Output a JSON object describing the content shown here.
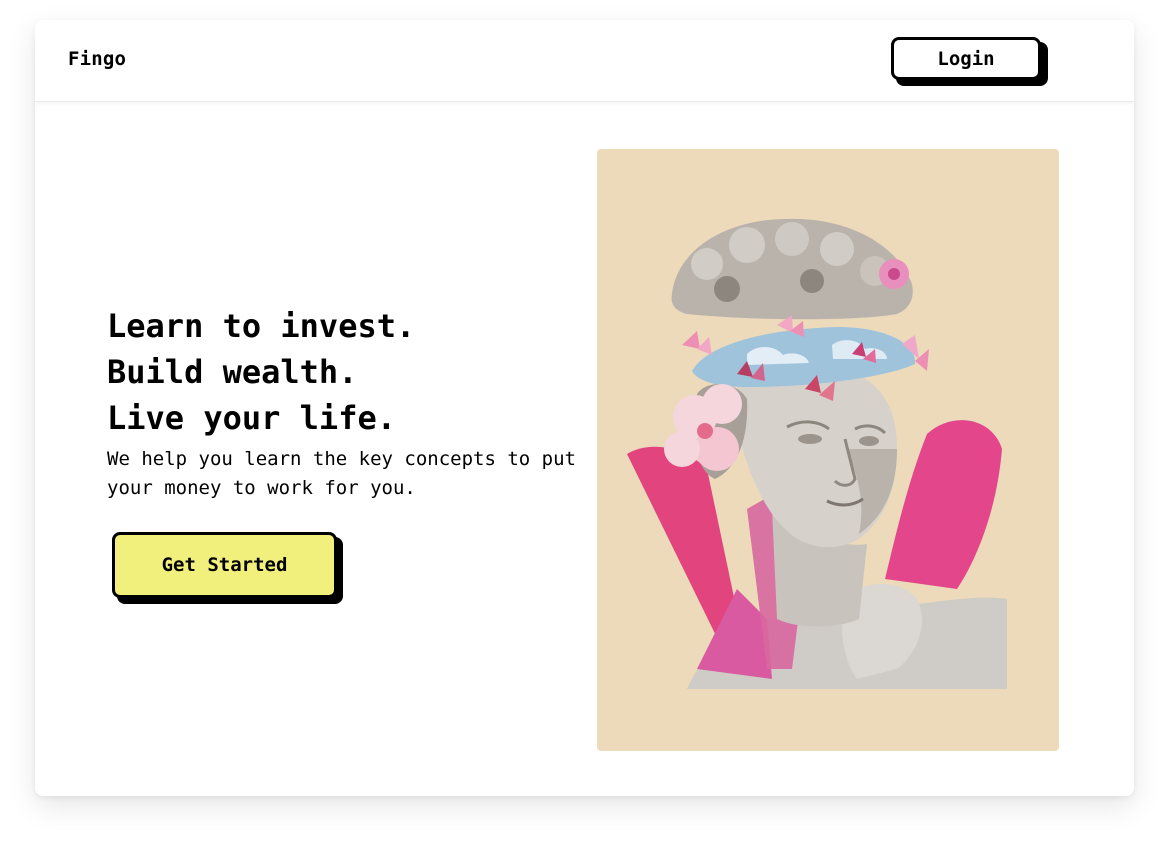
{
  "navbar": {
    "brand": "Fingo",
    "login_label": "Login"
  },
  "hero": {
    "headline_lines": [
      "Learn to invest.",
      "Build wealth.",
      "Live your life."
    ],
    "subtext": "We help you learn the key concepts to put your money to work for you.",
    "cta_label": "Get Started"
  },
  "artwork": {
    "description_icon": "statue-collage-illustration",
    "background_color": "#ecdabb"
  },
  "colors": {
    "cta_background": "#f2f07c",
    "button_border": "#000000",
    "accent_pink": "#e2447e"
  }
}
